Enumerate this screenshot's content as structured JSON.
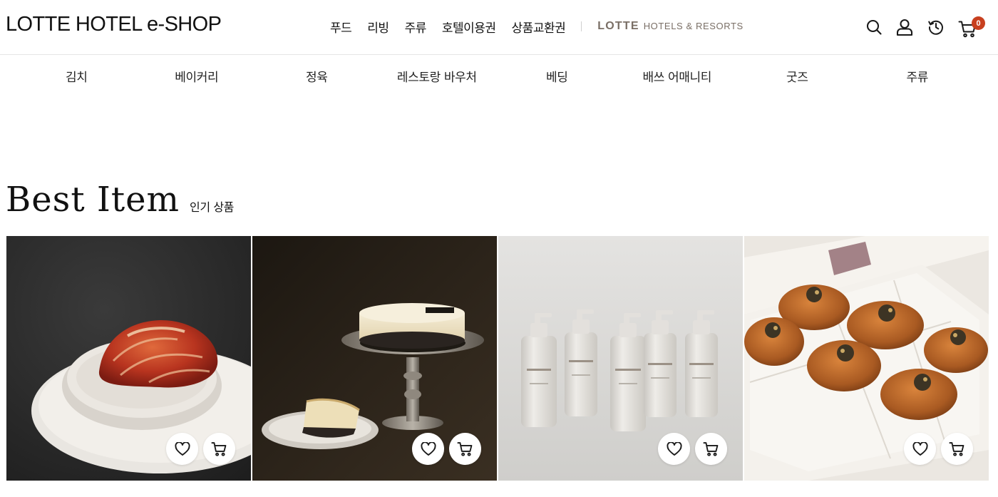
{
  "header": {
    "logo": "LOTTE HOTEL e-SHOP",
    "gnb": [
      "푸드",
      "리빙",
      "주류",
      "호텔이용권",
      "상품교환권"
    ],
    "brand": {
      "main": "LOTTE",
      "sub": "HOTELS & RESORTS"
    },
    "utility_icons": [
      "search-icon",
      "user-icon",
      "history-icon",
      "cart-icon"
    ],
    "cart_count": "0"
  },
  "category_nav": [
    "김치",
    "베이커리",
    "정육",
    "레스토랑 바우처",
    "베딩",
    "배쓰 어매니티",
    "굿즈",
    "주류"
  ],
  "best_item": {
    "title": "Best Item",
    "subtitle": "인기 상품",
    "products": [
      {
        "image": "kimchi",
        "actions": [
          "heart-icon",
          "cart-icon"
        ]
      },
      {
        "image": "cheesecake",
        "actions": [
          "heart-icon",
          "cart-icon"
        ]
      },
      {
        "image": "bath-amenity-bottles",
        "actions": [
          "heart-icon",
          "cart-icon"
        ]
      },
      {
        "image": "bread-box",
        "actions": [
          "heart-icon",
          "cart-icon"
        ]
      }
    ]
  },
  "colors": {
    "text": "#111111",
    "brand_gray": "#7a6f66",
    "cart_badge": "#c8401f",
    "divider": "#e6e6e6"
  }
}
